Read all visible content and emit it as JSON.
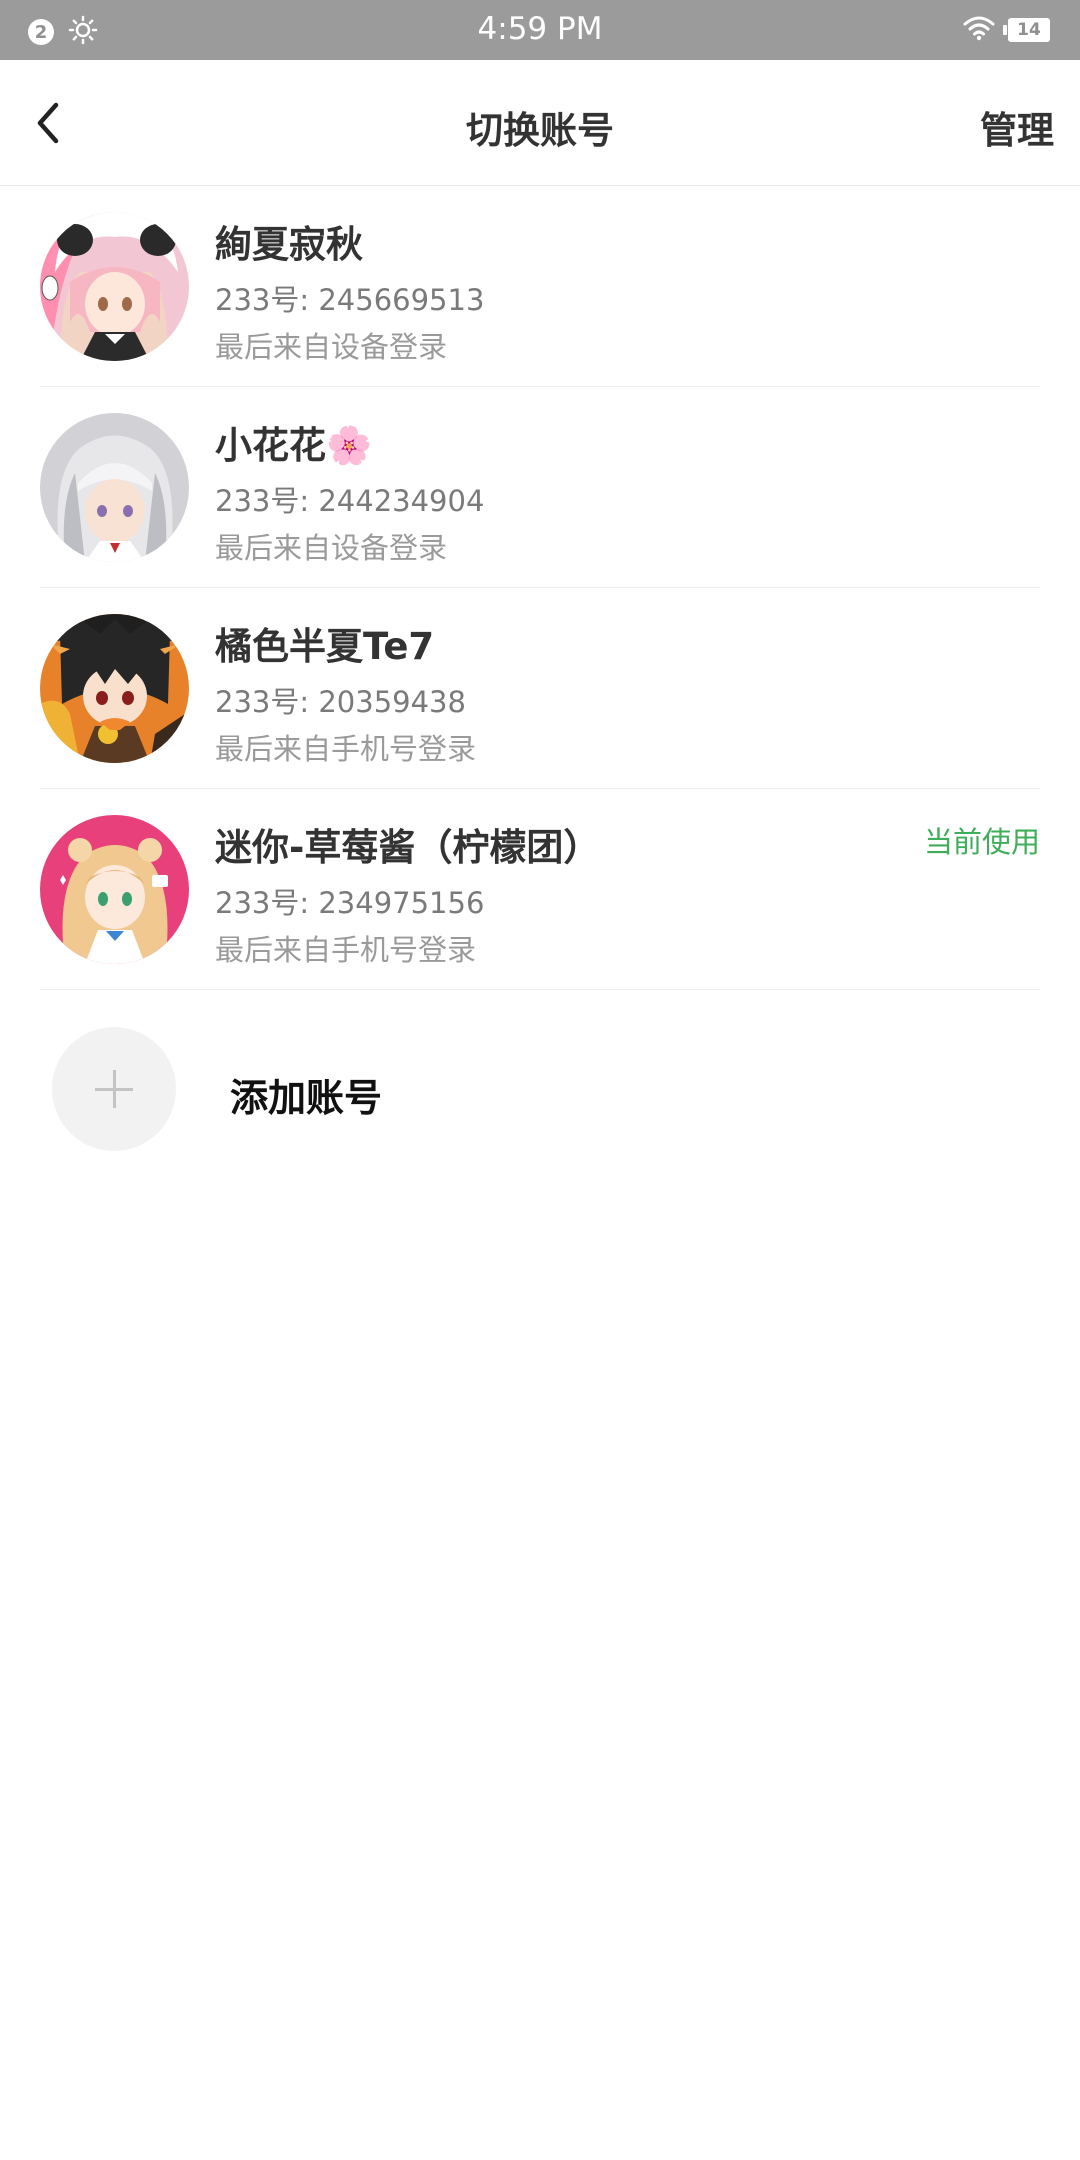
{
  "status_bar": {
    "notification_count": "2",
    "time": "4:59 PM",
    "battery": "14",
    "icons": [
      "notification-badge",
      "brightness-icon",
      "wifi-icon",
      "battery-icon"
    ]
  },
  "header": {
    "title": "切换账号",
    "manage": "管理",
    "back_icon": "chevron-left-icon"
  },
  "accounts": [
    {
      "name": "絢夏寂秋",
      "id": "233号: 245669513",
      "login": "最后来自设备登录",
      "current": "",
      "avatar": "anime-girl-panda-hood"
    },
    {
      "name": "小花花🌸",
      "id": "233号: 244234904",
      "login": "最后来自设备登录",
      "current": "",
      "avatar": "anime-girl-silver-hair"
    },
    {
      "name": "橘色半夏Te7",
      "id": "233号: 20359438",
      "login": "最后来自手机号登录",
      "current": "",
      "avatar": "anime-boy-tiger-costume"
    },
    {
      "name": "迷你-草莓酱（柠檬团）",
      "id": "233号: 234975156",
      "login": "最后来自手机号登录",
      "current": "当前使用",
      "avatar": "anime-girl-pink-background"
    }
  ],
  "add_account": {
    "label": "添加账号",
    "icon": "plus-icon"
  },
  "colors": {
    "status_bar_bg": "#9b9b9b",
    "current_tag": "#3fae5a",
    "text_primary": "#333333",
    "text_secondary": "#7a7a7a"
  }
}
